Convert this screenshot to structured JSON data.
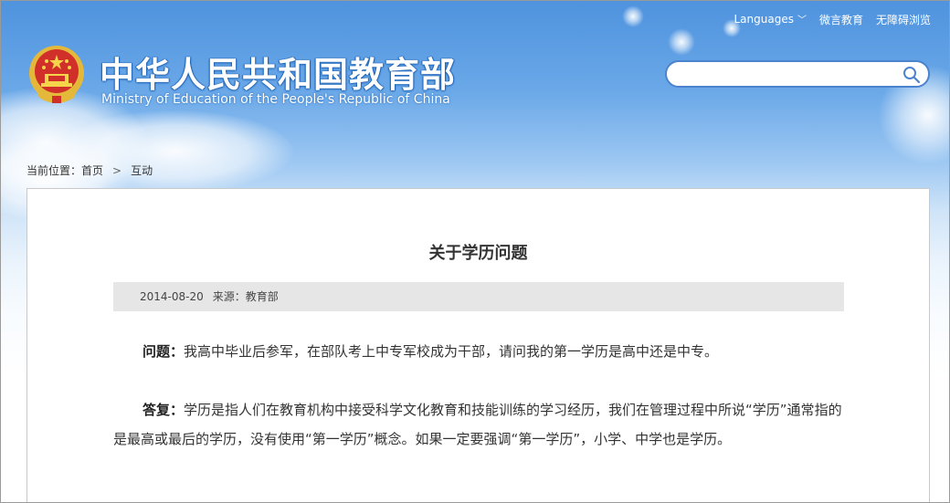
{
  "header": {
    "links": [
      "Languages",
      "微言教育",
      "无障碍浏览"
    ],
    "site_title_cn": "中华人民共和国教育部",
    "site_title_en": "Ministry of Education of the People's Republic of China",
    "search_placeholder": ""
  },
  "breadcrumb": {
    "prefix": "当前位置：",
    "items": [
      "首页",
      "互动"
    ],
    "separator": ">"
  },
  "article": {
    "title": "关于学历问题",
    "date": "2014-08-20",
    "source": "来源：教育部",
    "question_label": "问题：",
    "question_text": "我高中毕业后参军，在部队考上中专军校成为干部，请问我的第一学历是高中还是中专。",
    "answer_label": "答复：",
    "answer_text": "学历是指人们在教育机构中接受科学文化教育和技能训练的学习经历，我们在管理过程中所说“学历”通常指的是最高或最后的学历，没有使用“第一学历”概念。如果一定要强调“第一学历”，小学、中学也是学历。"
  },
  "icons": {
    "emblem": "national-emblem-icon",
    "search": "search-icon",
    "languages_dropdown": "chevron-down-icon"
  },
  "colors": {
    "sky_top": "#4f93de",
    "search_border": "#4c83cf",
    "meta_bar": "#e6e6e6"
  }
}
